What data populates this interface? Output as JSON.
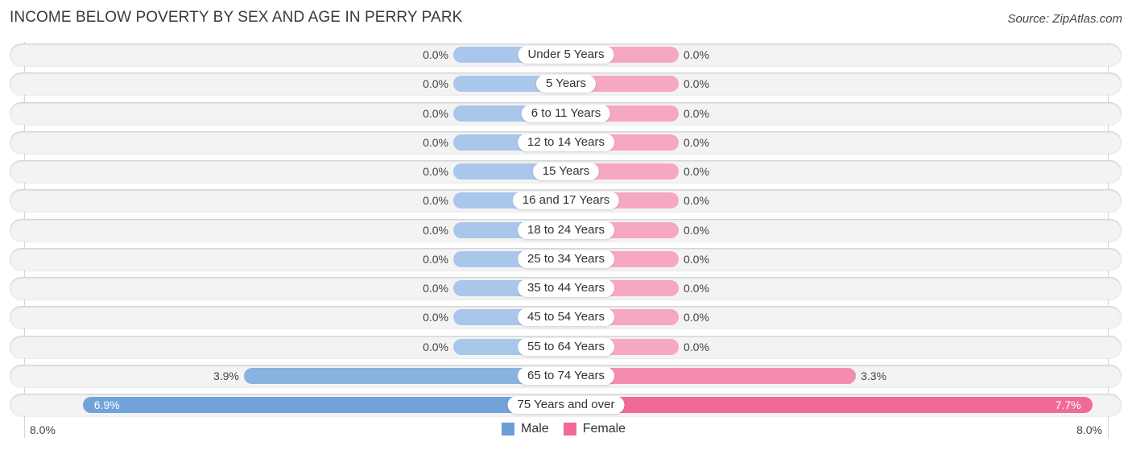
{
  "title": "INCOME BELOW POVERTY BY SEX AND AGE IN PERRY PARK",
  "source": "Source: ZipAtlas.com",
  "colors": {
    "male_light": "#a9c7ea",
    "male_dark": "#6a9fd8",
    "female_light": "#f6a8c0",
    "female_dark": "#f06a96",
    "row_bg": "#f3f3f3"
  },
  "chart_data": {
    "type": "bar",
    "orientation": "horizontal-diverging",
    "title": "INCOME BELOW POVERTY BY SEX AND AGE IN PERRY PARK",
    "categories": [
      "Under 5 Years",
      "5 Years",
      "6 to 11 Years",
      "12 to 14 Years",
      "15 Years",
      "16 and 17 Years",
      "18 to 24 Years",
      "25 to 34 Years",
      "35 to 44 Years",
      "45 to 54 Years",
      "55 to 64 Years",
      "65 to 74 Years",
      "75 Years and over"
    ],
    "series": [
      {
        "name": "Male",
        "values": [
          0.0,
          0.0,
          0.0,
          0.0,
          0.0,
          0.0,
          0.0,
          0.0,
          0.0,
          0.0,
          0.0,
          3.9,
          6.9
        ],
        "labels": [
          "0.0%",
          "0.0%",
          "0.0%",
          "0.0%",
          "0.0%",
          "0.0%",
          "0.0%",
          "0.0%",
          "0.0%",
          "0.0%",
          "0.0%",
          "3.9%",
          "6.9%"
        ]
      },
      {
        "name": "Female",
        "values": [
          0.0,
          0.0,
          0.0,
          0.0,
          0.0,
          0.0,
          0.0,
          0.0,
          0.0,
          0.0,
          0.0,
          3.3,
          7.7
        ],
        "labels": [
          "0.0%",
          "0.0%",
          "0.0%",
          "0.0%",
          "0.0%",
          "0.0%",
          "0.0%",
          "0.0%",
          "0.0%",
          "0.0%",
          "0.0%",
          "3.3%",
          "7.7%"
        ]
      }
    ],
    "xlim": [
      -8.0,
      8.0
    ],
    "axis_labels": {
      "left": "8.0%",
      "right": "8.0%"
    },
    "legend": {
      "position": "bottom-center",
      "entries": [
        "Male",
        "Female"
      ]
    },
    "unit": "%"
  }
}
